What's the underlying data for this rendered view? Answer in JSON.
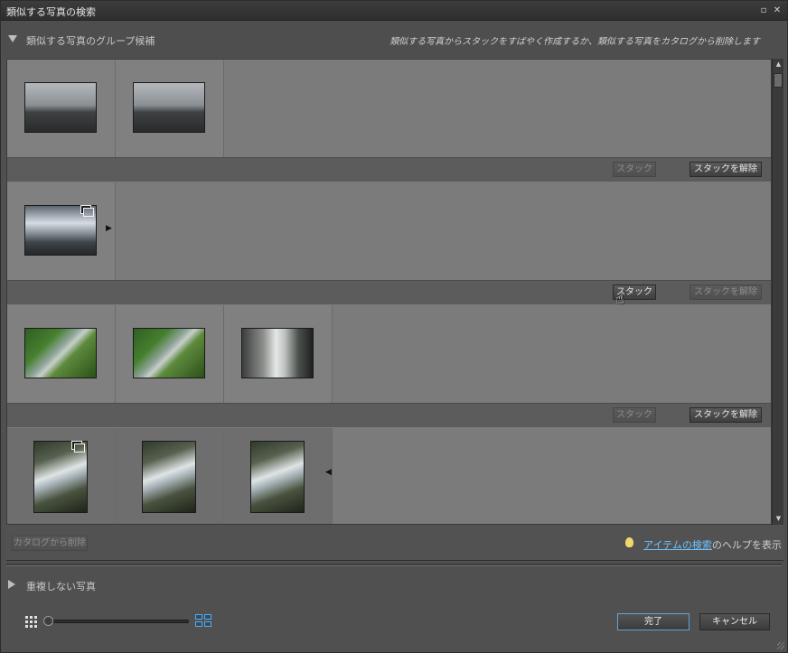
{
  "window": {
    "title": "類似する写真の検索"
  },
  "section": {
    "label": "類似する写真のグループ候補",
    "hint": "類似する写真からスタックをすばやく作成するか、類似する写真をカタログから削除します"
  },
  "buttons": {
    "stack": "スタック",
    "unstack": "スタックを解除",
    "remove_from_catalog": "カタログから削除",
    "ok": "完了",
    "cancel": "キャンセル"
  },
  "groups": [
    {
      "photos": [
        "mountain-landscape",
        "mountain-landscape"
      ],
      "stack_enabled": false,
      "unstack_enabled": true
    },
    {
      "photos": [
        "stacked-sky-landscape"
      ],
      "stack_enabled": true,
      "unstack_enabled": false
    },
    {
      "photos": [
        "green-river",
        "green-river",
        "waterfall"
      ],
      "stack_enabled": false,
      "unstack_enabled": true
    },
    {
      "photos": [
        "rapids-stacked",
        "rapids",
        "rapids"
      ],
      "stack_enabled": false,
      "unstack_enabled": false
    }
  ],
  "help": {
    "link": "アイテムの検索",
    "suffix": "のヘルプを表示"
  },
  "nondup": {
    "label": "重複しない写真"
  },
  "colors": {
    "link": "#6ec3ff",
    "primary_border": "#5ea4d8",
    "background": "#505050"
  }
}
